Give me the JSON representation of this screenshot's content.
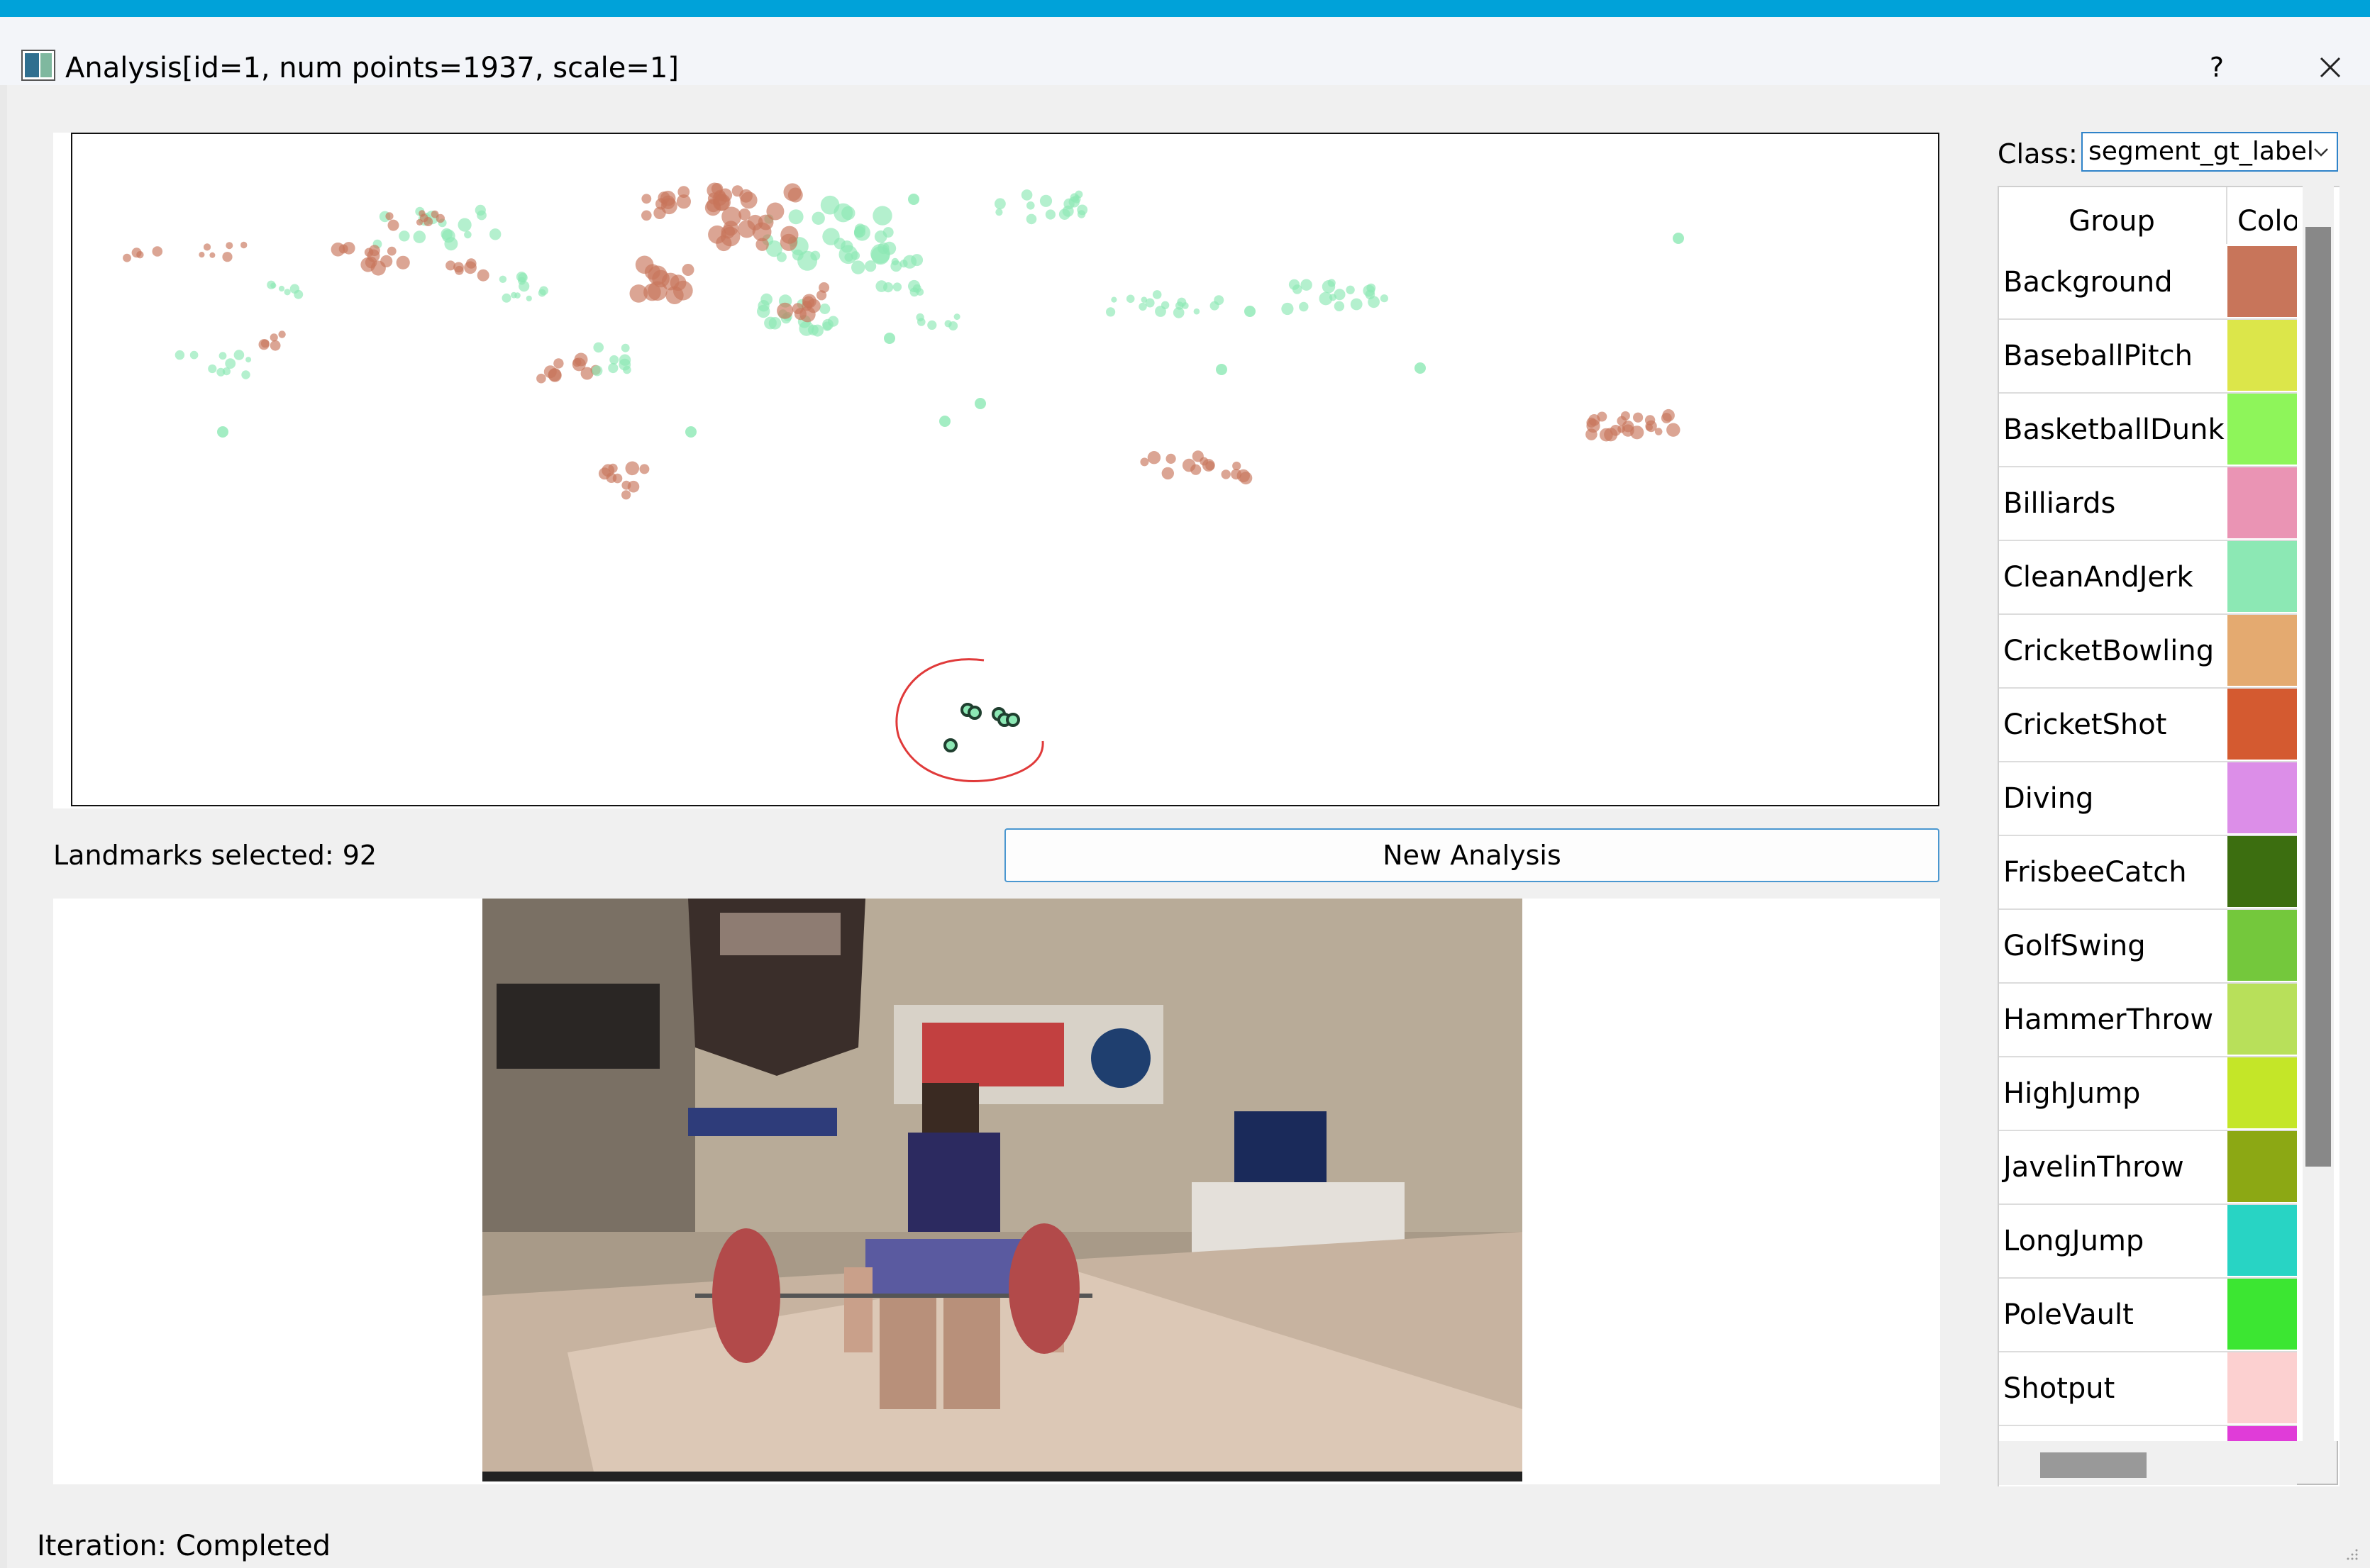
{
  "window": {
    "title": "Analysis[id=1, num points=1937, scale=1]",
    "help_label": "?",
    "close_icon": "close-icon",
    "accent_color": "#00a2d9"
  },
  "controls": {
    "landmarks_text": "Landmarks selected: 92",
    "new_analysis_label": "New Analysis",
    "status_text": "Iteration: Completed"
  },
  "class_selector": {
    "label": "Class:",
    "value": "segment_gt_label"
  },
  "groups_table": {
    "headers": [
      "Group",
      "Colo"
    ],
    "rows": [
      {
        "name": "Background",
        "color": "#c8755a"
      },
      {
        "name": "BaseballPitch",
        "color": "#dce64a"
      },
      {
        "name": "BasketballDunk",
        "color": "#8ef55a"
      },
      {
        "name": "Billiards",
        "color": "#ea94b4"
      },
      {
        "name": "CleanAndJerk",
        "color": "#8ce8b4"
      },
      {
        "name": "CricketBowling",
        "color": "#e4aa70"
      },
      {
        "name": "CricketShot",
        "color": "#d45a30"
      },
      {
        "name": "Diving",
        "color": "#dc8ee8"
      },
      {
        "name": "FrisbeeCatch",
        "color": "#3c6e10"
      },
      {
        "name": "GolfSwing",
        "color": "#74c83c"
      },
      {
        "name": "HammerThrow",
        "color": "#b8e05a"
      },
      {
        "name": "HighJump",
        "color": "#c4e628"
      },
      {
        "name": "JavelinThrow",
        "color": "#8ca814"
      },
      {
        "name": "LongJump",
        "color": "#28d4c4"
      },
      {
        "name": "PoleVault",
        "color": "#3ce632"
      },
      {
        "name": "Shotput",
        "color": "#fcd0d0"
      },
      {
        "name": "",
        "color": "#e03cd8"
      }
    ]
  },
  "scatter": {
    "series_colors": {
      "Background": "#c8755a",
      "CleanAndJerk": "#8ce8b4"
    },
    "selected_color": "#1f3f2f",
    "lasso_color": "#e03a3a"
  }
}
